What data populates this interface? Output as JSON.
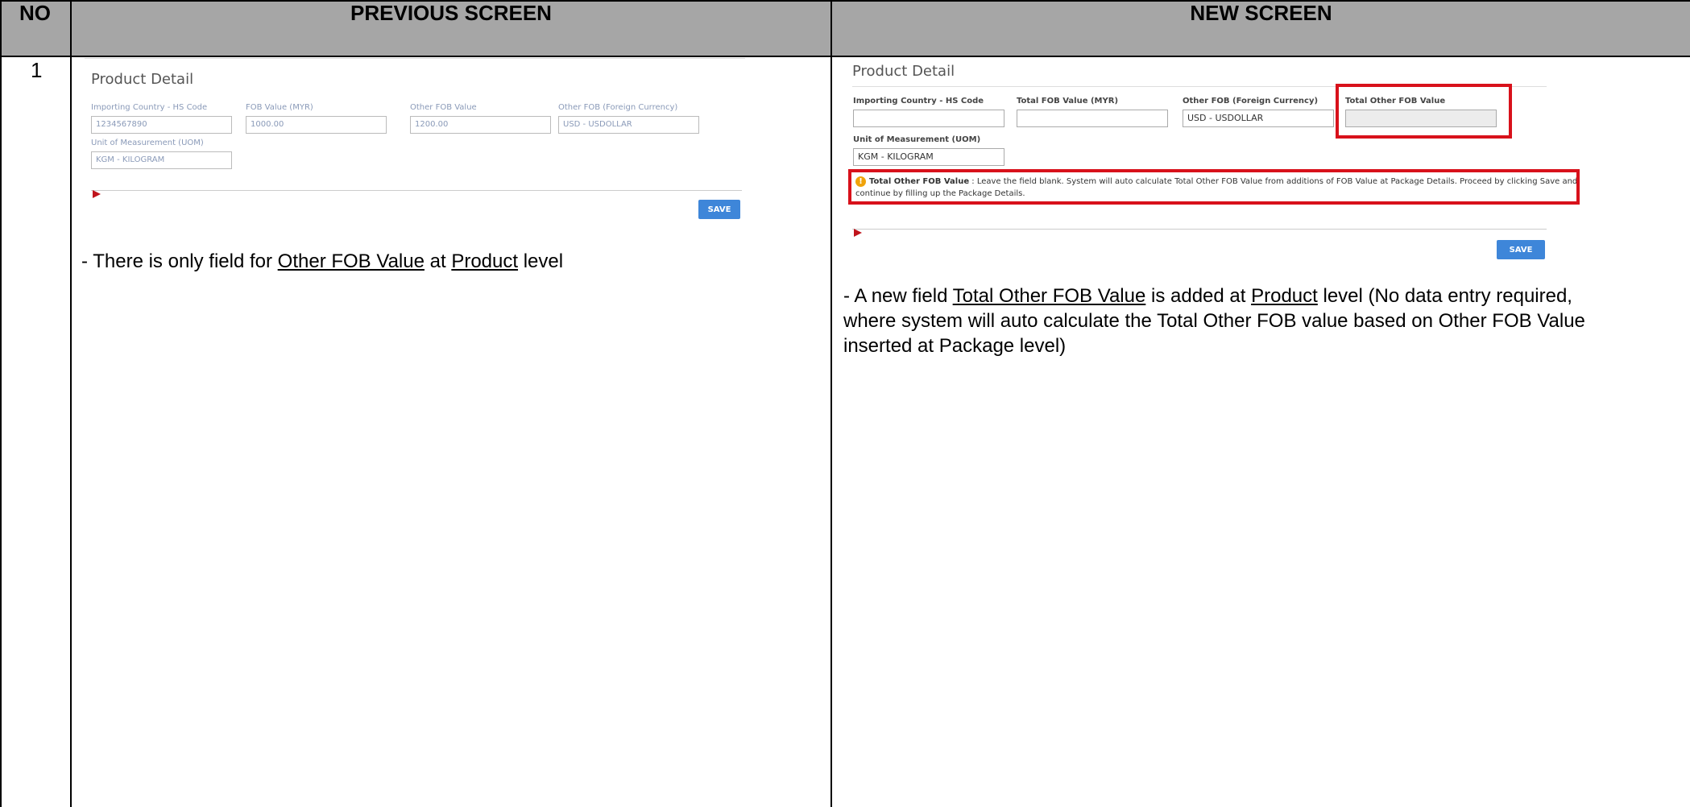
{
  "header": {
    "no": "NO",
    "previous": "PREVIOUS SCREEN",
    "new": "NEW SCREEN"
  },
  "row": {
    "number": "1"
  },
  "previous_screen": {
    "title": "Product Detail",
    "fields": {
      "hs_code_label": "Importing Country - HS Code",
      "hs_code_value": "1234567890",
      "fob_label": "FOB Value (MYR)",
      "fob_value": "1000.00",
      "other_fob_label": "Other FOB Value",
      "other_fob_value": "1200.00",
      "currency_label": "Other FOB (Foreign Currency)",
      "currency_value": "USD - USDOLLAR",
      "uom_label": "Unit of Measurement (UOM)",
      "uom_value": "KGM - KILOGRAM"
    },
    "save_label": "SAVE",
    "description": {
      "prefix": "- There is only field for ",
      "term1": "Other FOB Value",
      "mid": " at ",
      "term2": "Product",
      "suffix": " level"
    }
  },
  "new_screen": {
    "title": "Product Detail",
    "fields": {
      "hs_code_label": "Importing Country - HS Code",
      "hs_code_value": "",
      "total_fob_label": "Total FOB Value (MYR)",
      "total_fob_value": "",
      "currency_label": "Other FOB (Foreign Currency)",
      "currency_value": "USD - USDOLLAR",
      "total_other_fob_label": "Total Other FOB Value",
      "total_other_fob_value": "",
      "uom_label": "Unit of Measurement (UOM)",
      "uom_value": "KGM - KILOGRAM"
    },
    "note": {
      "bold": "Total Other FOB Value",
      "line1": " : Leave the field blank. System will auto calculate Total Other FOB Value from additions of FOB Value at Package Details. Proceed by clicking Save and",
      "line2": "continue by filling up the Package Details."
    },
    "save_label": "SAVE",
    "description": {
      "prefix": "- A new field ",
      "term1": "Total Other FOB Value",
      "mid1": " is added at ",
      "term2": "Product",
      "line1_suffix": " level (No data entry required,",
      "line2": "where system will auto calculate the Total Other FOB value based on Other FOB Value",
      "line3": "inserted at Package level)"
    }
  },
  "colors": {
    "header_bg": "#a6a6a6",
    "highlight_red": "#d8111b",
    "save_blue": "#3e86d9"
  }
}
